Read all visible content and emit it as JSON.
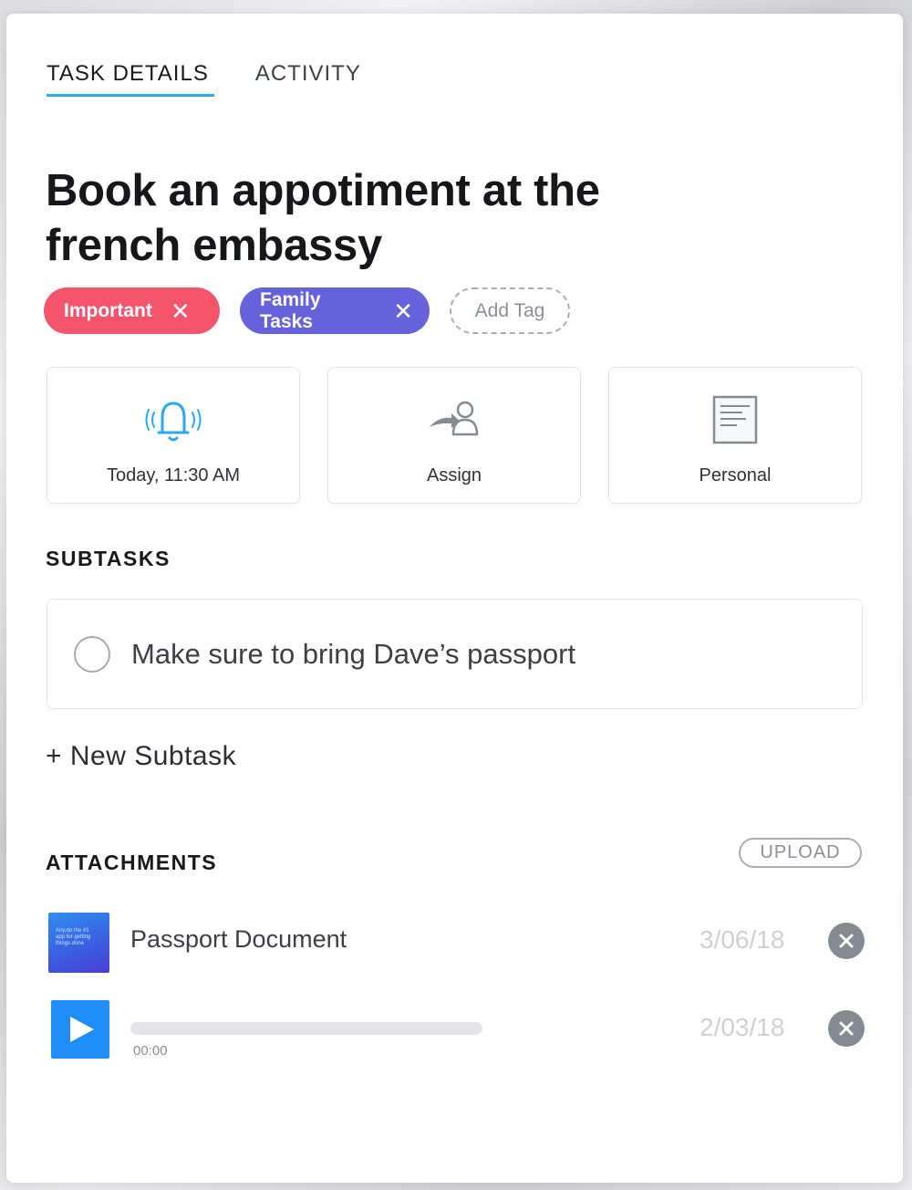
{
  "tabs": [
    {
      "label": "TASK DETAILS",
      "active": true
    },
    {
      "label": "ACTIVITY",
      "active": false
    }
  ],
  "task": {
    "title_line1": "Book an appotiment at the",
    "title_line2": "french embassy"
  },
  "tags": [
    {
      "label": "Important",
      "color": "#f5546d",
      "icon": "close-icon"
    },
    {
      "label": "Family Tasks",
      "color": "#6662dc",
      "icon": "close-icon"
    }
  ],
  "add_tag_label": "Add Tag",
  "cards": [
    {
      "label": "Today, 11:30 AM",
      "icon": "bell-icon"
    },
    {
      "label": "Assign",
      "icon": "assign-user-icon"
    },
    {
      "label": "Personal",
      "icon": "document-icon"
    }
  ],
  "subtasks_heading": "SUBTASKS",
  "subtasks": [
    {
      "text": "Make sure to bring Dave’s passport",
      "done": false
    }
  ],
  "new_subtask_label": "+ New Subtask",
  "attachments_heading": "ATTACHMENTS",
  "upload_label": "UPLOAD",
  "attachments": [
    {
      "type": "document",
      "name": "Passport Document",
      "date": "3/06/18",
      "thumb_text": "Any.do the #1 app for getting things done"
    },
    {
      "type": "audio",
      "time": "00:00",
      "date": "2/03/18",
      "progress": 0
    }
  ],
  "colors": {
    "accent": "#2aa9f2",
    "play": "#1f8cf7"
  }
}
